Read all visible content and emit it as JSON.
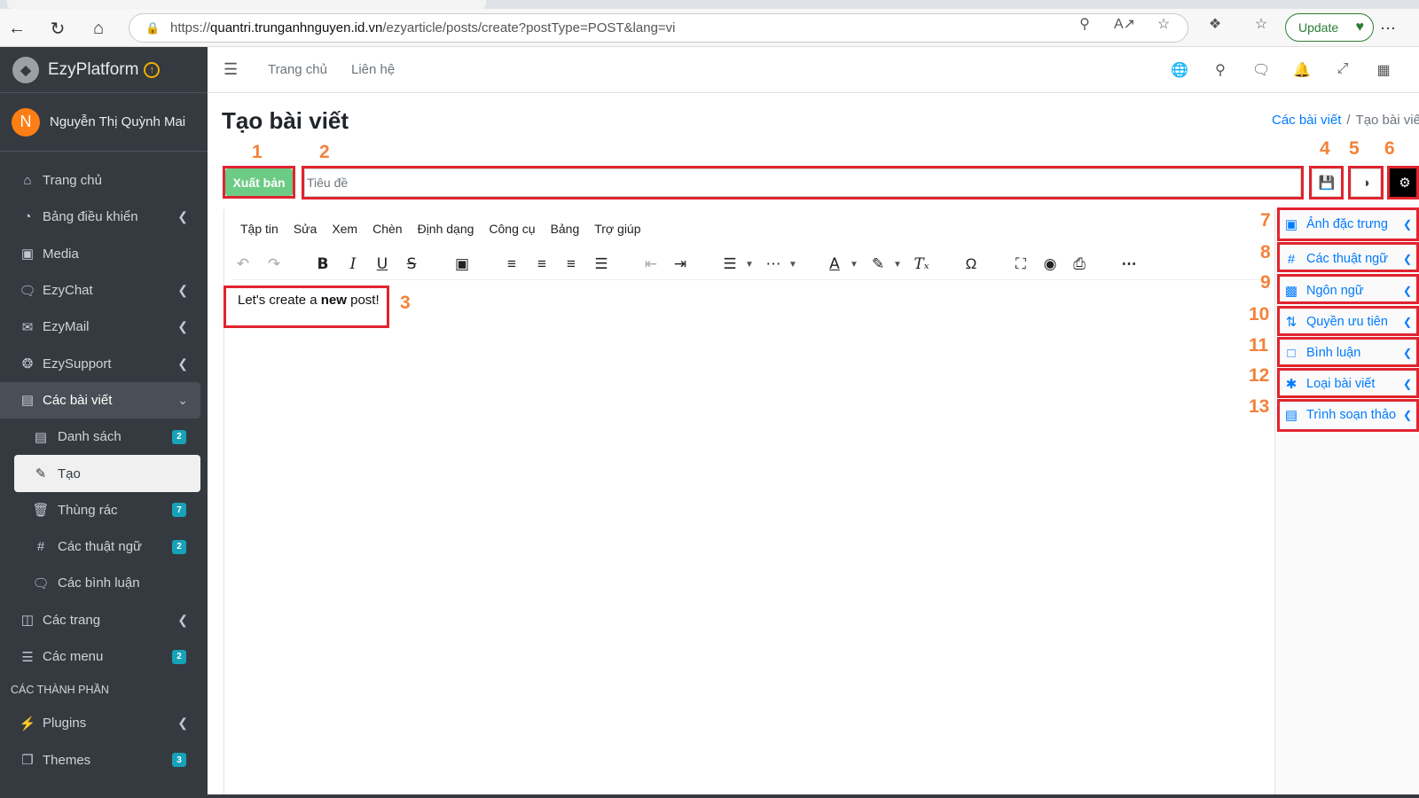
{
  "browser": {
    "url_prefix": "https://",
    "url_host": "quantri.trunganhnguyen.id.vn",
    "url_path": "/ezyarticle/posts/create?postType=POST&lang=vi",
    "update_label": "Update"
  },
  "brand": {
    "name": "EzyPlatform"
  },
  "user": {
    "initial": "N",
    "name": "Nguyễn Thị Quỳnh Mai"
  },
  "sidebar": {
    "items": [
      {
        "label": "Trang chủ"
      },
      {
        "label": "Bảng điều khiển"
      },
      {
        "label": "Media"
      },
      {
        "label": "EzyChat"
      },
      {
        "label": "EzyMail"
      },
      {
        "label": "EzySupport"
      },
      {
        "label": "Các bài viết"
      },
      {
        "label": "Danh sách",
        "badge": "2"
      },
      {
        "label": "Tạo"
      },
      {
        "label": "Thùng rác",
        "badge": "7"
      },
      {
        "label": "Các thuật ngữ",
        "badge": "2"
      },
      {
        "label": "Các bình luận"
      },
      {
        "label": "Các trang"
      },
      {
        "label": "Các menu",
        "badge": "2"
      }
    ],
    "section_header": "CÁC THÀNH PHẦN",
    "components": [
      {
        "label": "Plugins"
      },
      {
        "label": "Themes",
        "badge": "3"
      }
    ]
  },
  "topnav": {
    "home": "Trang chủ",
    "contact": "Liên hệ"
  },
  "page": {
    "title": "Tạo bài viết",
    "breadcrumb": {
      "parent": "Các bài viết",
      "separator": "/",
      "current": "Tạo bài viết"
    }
  },
  "form": {
    "publish_label": "Xuất bản",
    "title_placeholder": "Tiêu đề",
    "title_value": ""
  },
  "editor": {
    "menus": [
      "Tập tin",
      "Sửa",
      "Xem",
      "Chèn",
      "Định dạng",
      "Công cụ",
      "Bảng",
      "Trợ giúp"
    ],
    "content_before": "Let's create a ",
    "content_bold": "new",
    "content_after": " post!"
  },
  "right_panel": {
    "items": [
      {
        "label": "Ảnh đặc trưng"
      },
      {
        "label": "Các thuật ngữ"
      },
      {
        "label": "Ngôn ngữ"
      },
      {
        "label": "Quyền ưu tiên"
      },
      {
        "label": "Bình luận"
      },
      {
        "label": "Loại bài viết"
      },
      {
        "label": "Trình soạn thảo"
      }
    ]
  },
  "annotations": [
    "1",
    "2",
    "3",
    "4",
    "5",
    "6",
    "7",
    "8",
    "9",
    "10",
    "11",
    "12",
    "13"
  ],
  "colors": {
    "sidebar_bg": "#343a40",
    "annotation_number": "#f4823b",
    "highlight_border": "#e0242f",
    "publish_green": "#6ccb84",
    "link_blue": "#007bff"
  }
}
